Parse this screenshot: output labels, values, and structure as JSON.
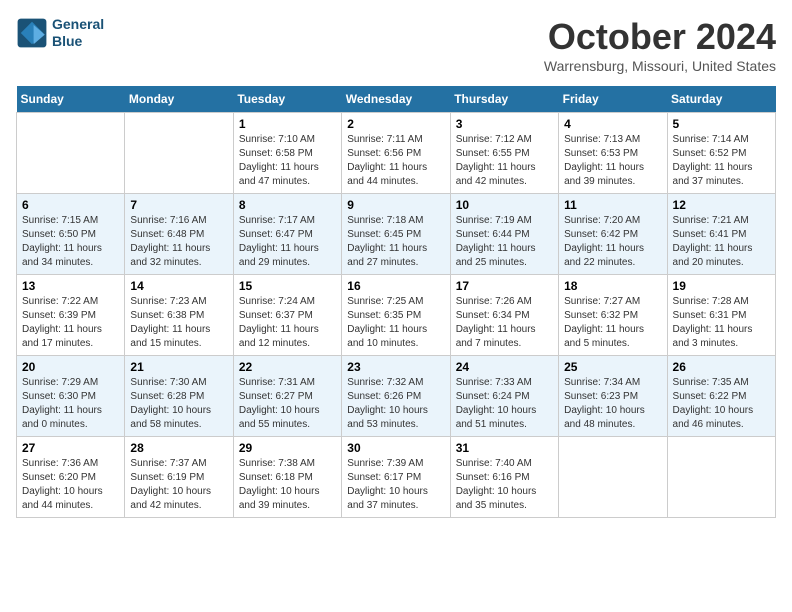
{
  "header": {
    "logo_line1": "General",
    "logo_line2": "Blue",
    "month": "October 2024",
    "location": "Warrensburg, Missouri, United States"
  },
  "weekdays": [
    "Sunday",
    "Monday",
    "Tuesday",
    "Wednesday",
    "Thursday",
    "Friday",
    "Saturday"
  ],
  "weeks": [
    [
      {
        "day": "",
        "info": ""
      },
      {
        "day": "",
        "info": ""
      },
      {
        "day": "1",
        "info": "Sunrise: 7:10 AM\nSunset: 6:58 PM\nDaylight: 11 hours and 47 minutes."
      },
      {
        "day": "2",
        "info": "Sunrise: 7:11 AM\nSunset: 6:56 PM\nDaylight: 11 hours and 44 minutes."
      },
      {
        "day": "3",
        "info": "Sunrise: 7:12 AM\nSunset: 6:55 PM\nDaylight: 11 hours and 42 minutes."
      },
      {
        "day": "4",
        "info": "Sunrise: 7:13 AM\nSunset: 6:53 PM\nDaylight: 11 hours and 39 minutes."
      },
      {
        "day": "5",
        "info": "Sunrise: 7:14 AM\nSunset: 6:52 PM\nDaylight: 11 hours and 37 minutes."
      }
    ],
    [
      {
        "day": "6",
        "info": "Sunrise: 7:15 AM\nSunset: 6:50 PM\nDaylight: 11 hours and 34 minutes."
      },
      {
        "day": "7",
        "info": "Sunrise: 7:16 AM\nSunset: 6:48 PM\nDaylight: 11 hours and 32 minutes."
      },
      {
        "day": "8",
        "info": "Sunrise: 7:17 AM\nSunset: 6:47 PM\nDaylight: 11 hours and 29 minutes."
      },
      {
        "day": "9",
        "info": "Sunrise: 7:18 AM\nSunset: 6:45 PM\nDaylight: 11 hours and 27 minutes."
      },
      {
        "day": "10",
        "info": "Sunrise: 7:19 AM\nSunset: 6:44 PM\nDaylight: 11 hours and 25 minutes."
      },
      {
        "day": "11",
        "info": "Sunrise: 7:20 AM\nSunset: 6:42 PM\nDaylight: 11 hours and 22 minutes."
      },
      {
        "day": "12",
        "info": "Sunrise: 7:21 AM\nSunset: 6:41 PM\nDaylight: 11 hours and 20 minutes."
      }
    ],
    [
      {
        "day": "13",
        "info": "Sunrise: 7:22 AM\nSunset: 6:39 PM\nDaylight: 11 hours and 17 minutes."
      },
      {
        "day": "14",
        "info": "Sunrise: 7:23 AM\nSunset: 6:38 PM\nDaylight: 11 hours and 15 minutes."
      },
      {
        "day": "15",
        "info": "Sunrise: 7:24 AM\nSunset: 6:37 PM\nDaylight: 11 hours and 12 minutes."
      },
      {
        "day": "16",
        "info": "Sunrise: 7:25 AM\nSunset: 6:35 PM\nDaylight: 11 hours and 10 minutes."
      },
      {
        "day": "17",
        "info": "Sunrise: 7:26 AM\nSunset: 6:34 PM\nDaylight: 11 hours and 7 minutes."
      },
      {
        "day": "18",
        "info": "Sunrise: 7:27 AM\nSunset: 6:32 PM\nDaylight: 11 hours and 5 minutes."
      },
      {
        "day": "19",
        "info": "Sunrise: 7:28 AM\nSunset: 6:31 PM\nDaylight: 11 hours and 3 minutes."
      }
    ],
    [
      {
        "day": "20",
        "info": "Sunrise: 7:29 AM\nSunset: 6:30 PM\nDaylight: 11 hours and 0 minutes."
      },
      {
        "day": "21",
        "info": "Sunrise: 7:30 AM\nSunset: 6:28 PM\nDaylight: 10 hours and 58 minutes."
      },
      {
        "day": "22",
        "info": "Sunrise: 7:31 AM\nSunset: 6:27 PM\nDaylight: 10 hours and 55 minutes."
      },
      {
        "day": "23",
        "info": "Sunrise: 7:32 AM\nSunset: 6:26 PM\nDaylight: 10 hours and 53 minutes."
      },
      {
        "day": "24",
        "info": "Sunrise: 7:33 AM\nSunset: 6:24 PM\nDaylight: 10 hours and 51 minutes."
      },
      {
        "day": "25",
        "info": "Sunrise: 7:34 AM\nSunset: 6:23 PM\nDaylight: 10 hours and 48 minutes."
      },
      {
        "day": "26",
        "info": "Sunrise: 7:35 AM\nSunset: 6:22 PM\nDaylight: 10 hours and 46 minutes."
      }
    ],
    [
      {
        "day": "27",
        "info": "Sunrise: 7:36 AM\nSunset: 6:20 PM\nDaylight: 10 hours and 44 minutes."
      },
      {
        "day": "28",
        "info": "Sunrise: 7:37 AM\nSunset: 6:19 PM\nDaylight: 10 hours and 42 minutes."
      },
      {
        "day": "29",
        "info": "Sunrise: 7:38 AM\nSunset: 6:18 PM\nDaylight: 10 hours and 39 minutes."
      },
      {
        "day": "30",
        "info": "Sunrise: 7:39 AM\nSunset: 6:17 PM\nDaylight: 10 hours and 37 minutes."
      },
      {
        "day": "31",
        "info": "Sunrise: 7:40 AM\nSunset: 6:16 PM\nDaylight: 10 hours and 35 minutes."
      },
      {
        "day": "",
        "info": ""
      },
      {
        "day": "",
        "info": ""
      }
    ]
  ]
}
